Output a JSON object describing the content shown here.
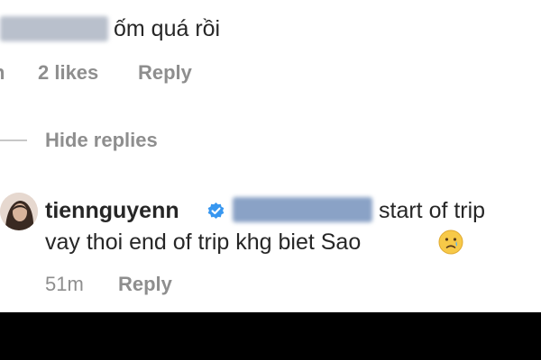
{
  "comment1": {
    "text": "ốm quá rồi",
    "time_fragment": "h",
    "likes": "2 likes",
    "reply": "Reply"
  },
  "hide_replies": "Hide replies",
  "reply_comment": {
    "username": "tiennguyenn",
    "line1": "start of trip",
    "line2": "vay thoi end of trip khg biet Sao",
    "emoji": "crying-face-emoji",
    "time": "51m",
    "reply": "Reply"
  },
  "colors": {
    "text": "#262626",
    "meta": "#8e8e8e",
    "verified": "#3897f0",
    "mention_blur": "#6d88b3",
    "bottom_bar": "#000000"
  }
}
